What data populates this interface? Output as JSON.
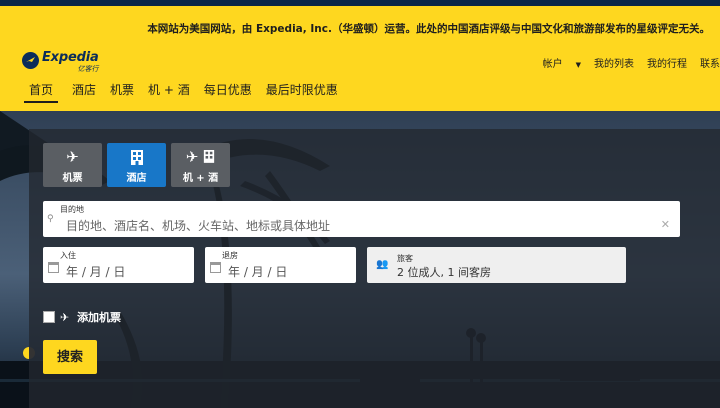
{
  "header": {
    "notice": "本网站为美国网站，由 Expedia, Inc.（华盛顿）运营。此处的中国酒店评级与中国文化和旅游部发布的星级评定无关。",
    "logo": {
      "name": "Expedia",
      "sub": "亿客行"
    },
    "account_nav": {
      "account": "帐户",
      "my_list": "我的列表",
      "my_trips": "我的行程",
      "contact": "联系"
    },
    "main_nav": [
      {
        "label": "首页",
        "active": true
      },
      {
        "label": "酒店"
      },
      {
        "label": "机票"
      },
      {
        "label": "机 + 酒"
      },
      {
        "label": "每日优惠"
      },
      {
        "label": "最后时限优惠"
      }
    ]
  },
  "search": {
    "tabs": [
      {
        "label": "机票",
        "icon": "plane-icon"
      },
      {
        "label": "酒店",
        "icon": "hotel-icon",
        "active": true
      },
      {
        "label": "机 + 酒",
        "icon": "plane-hotel-icon"
      }
    ],
    "destination": {
      "label": "目的地",
      "placeholder": "目的地、酒店名、机场、火车站、地标或具体地址"
    },
    "checkin": {
      "label": "入住",
      "placeholder": "年 / 月 / 日"
    },
    "checkout": {
      "label": "退房",
      "placeholder": "年 / 月 / 日"
    },
    "guests": {
      "label": "旅客",
      "value": "2 位成人, 1 间客房"
    },
    "add_flight": "添加机票",
    "search_button": "搜索"
  },
  "colors": {
    "brand_yellow": "#fed71f",
    "brand_navy": "#0b2c5a",
    "active_tab": "#1877c8"
  }
}
